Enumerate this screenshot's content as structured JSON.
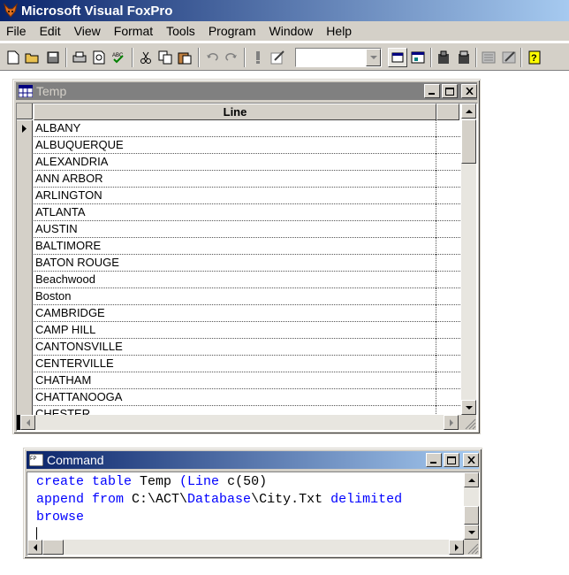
{
  "app": {
    "title": "Microsoft Visual FoxPro"
  },
  "menu": [
    "File",
    "Edit",
    "View",
    "Format",
    "Tools",
    "Program",
    "Window",
    "Help"
  ],
  "browse_window": {
    "title": "Temp",
    "column_header": "Line",
    "rows": [
      "ALBANY",
      "ALBUQUERQUE",
      "ALEXANDRIA",
      "ANN ARBOR",
      "ARLINGTON",
      "ATLANTA",
      "AUSTIN",
      "BALTIMORE",
      "BATON ROUGE",
      "Beachwood",
      "Boston",
      "CAMBRIDGE",
      "CAMP HILL",
      "CANTONSVILLE",
      "CENTERVILLE",
      "CHATHAM",
      "CHATTANOOGA",
      "CHESTER"
    ]
  },
  "command_window": {
    "title": "Command",
    "lines": [
      [
        {
          "t": "create table ",
          "k": true
        },
        {
          "t": "Temp ",
          "k": false
        },
        {
          "t": "(Line ",
          "k": true
        },
        {
          "t": "c(50)",
          "k": false
        }
      ],
      [
        {
          "t": "append from ",
          "k": true
        },
        {
          "t": "C:\\ACT\\",
          "k": false
        },
        {
          "t": "Database",
          "k": true
        },
        {
          "t": "\\City.Txt ",
          "k": false
        },
        {
          "t": "delimited",
          "k": true
        }
      ],
      [
        {
          "t": "browse",
          "k": true
        }
      ]
    ]
  },
  "colors": {
    "title_start": "#0a246a",
    "title_end": "#a6caf0",
    "inactive_title": "#808080",
    "keyword": "#0000ff",
    "face": "#d4d0c8"
  }
}
